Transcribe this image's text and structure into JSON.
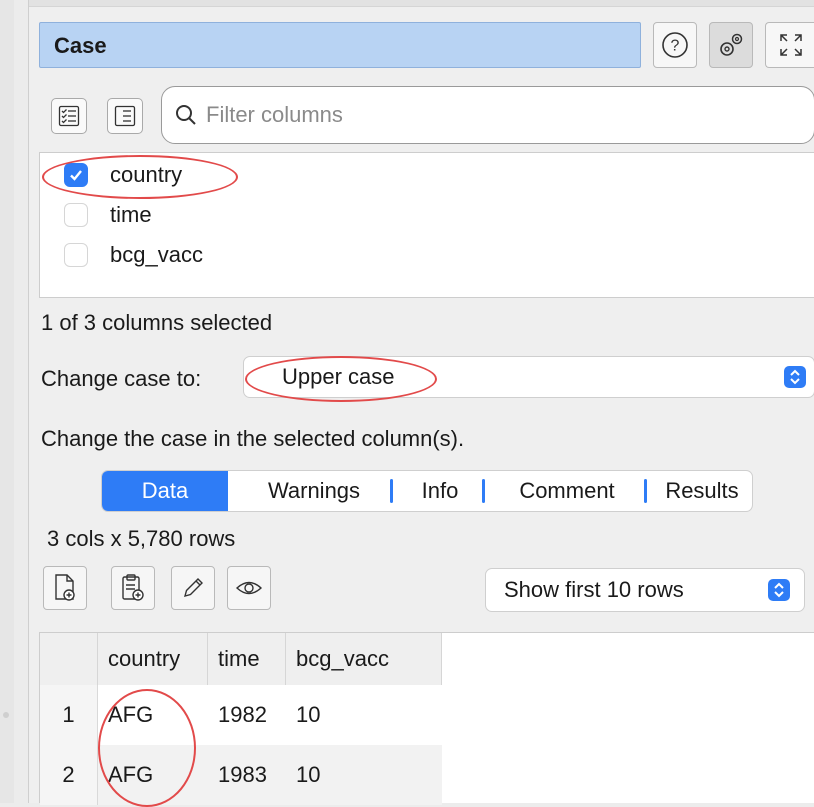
{
  "header": {
    "title": "Case",
    "help_icon": "question-circle-icon",
    "settings_icon": "gears-icon",
    "expand_icon": "expand-arrows-icon"
  },
  "filter": {
    "select_all_icon": "checklist-icon",
    "deselect_icon": "list-icon",
    "search_icon": "magnifier-icon",
    "placeholder": "Filter columns"
  },
  "columns": [
    {
      "name": "country",
      "checked": true
    },
    {
      "name": "time",
      "checked": false
    },
    {
      "name": "bcg_vacc",
      "checked": false
    }
  ],
  "selection_summary": "1 of 3 columns selected",
  "change_case": {
    "label": "Change case to:",
    "value": "Upper case"
  },
  "description": "Change the case in the selected column(s).",
  "tabs": [
    {
      "label": "Data",
      "active": true
    },
    {
      "label": "Warnings",
      "active": false
    },
    {
      "label": "Info",
      "active": false
    },
    {
      "label": "Comment",
      "active": false
    },
    {
      "label": "Results",
      "active": false
    }
  ],
  "data_panel": {
    "dimensions": "3 cols x 5,780 rows",
    "toolbar_icons": [
      "export-file-icon",
      "copy-clipboard-icon",
      "pencil-icon",
      "eye-icon"
    ],
    "rows_option": "Show first 10 rows",
    "table": {
      "headers": [
        "country",
        "time",
        "bcg_vacc"
      ],
      "rows": [
        {
          "num": "1",
          "cells": [
            "AFG",
            "1982",
            "10"
          ]
        },
        {
          "num": "2",
          "cells": [
            "AFG",
            "1983",
            "10"
          ]
        }
      ]
    }
  },
  "colors": {
    "accent": "#2e7cf6",
    "title_bg": "#b8d3f3",
    "annotation": "#e24a4a"
  }
}
